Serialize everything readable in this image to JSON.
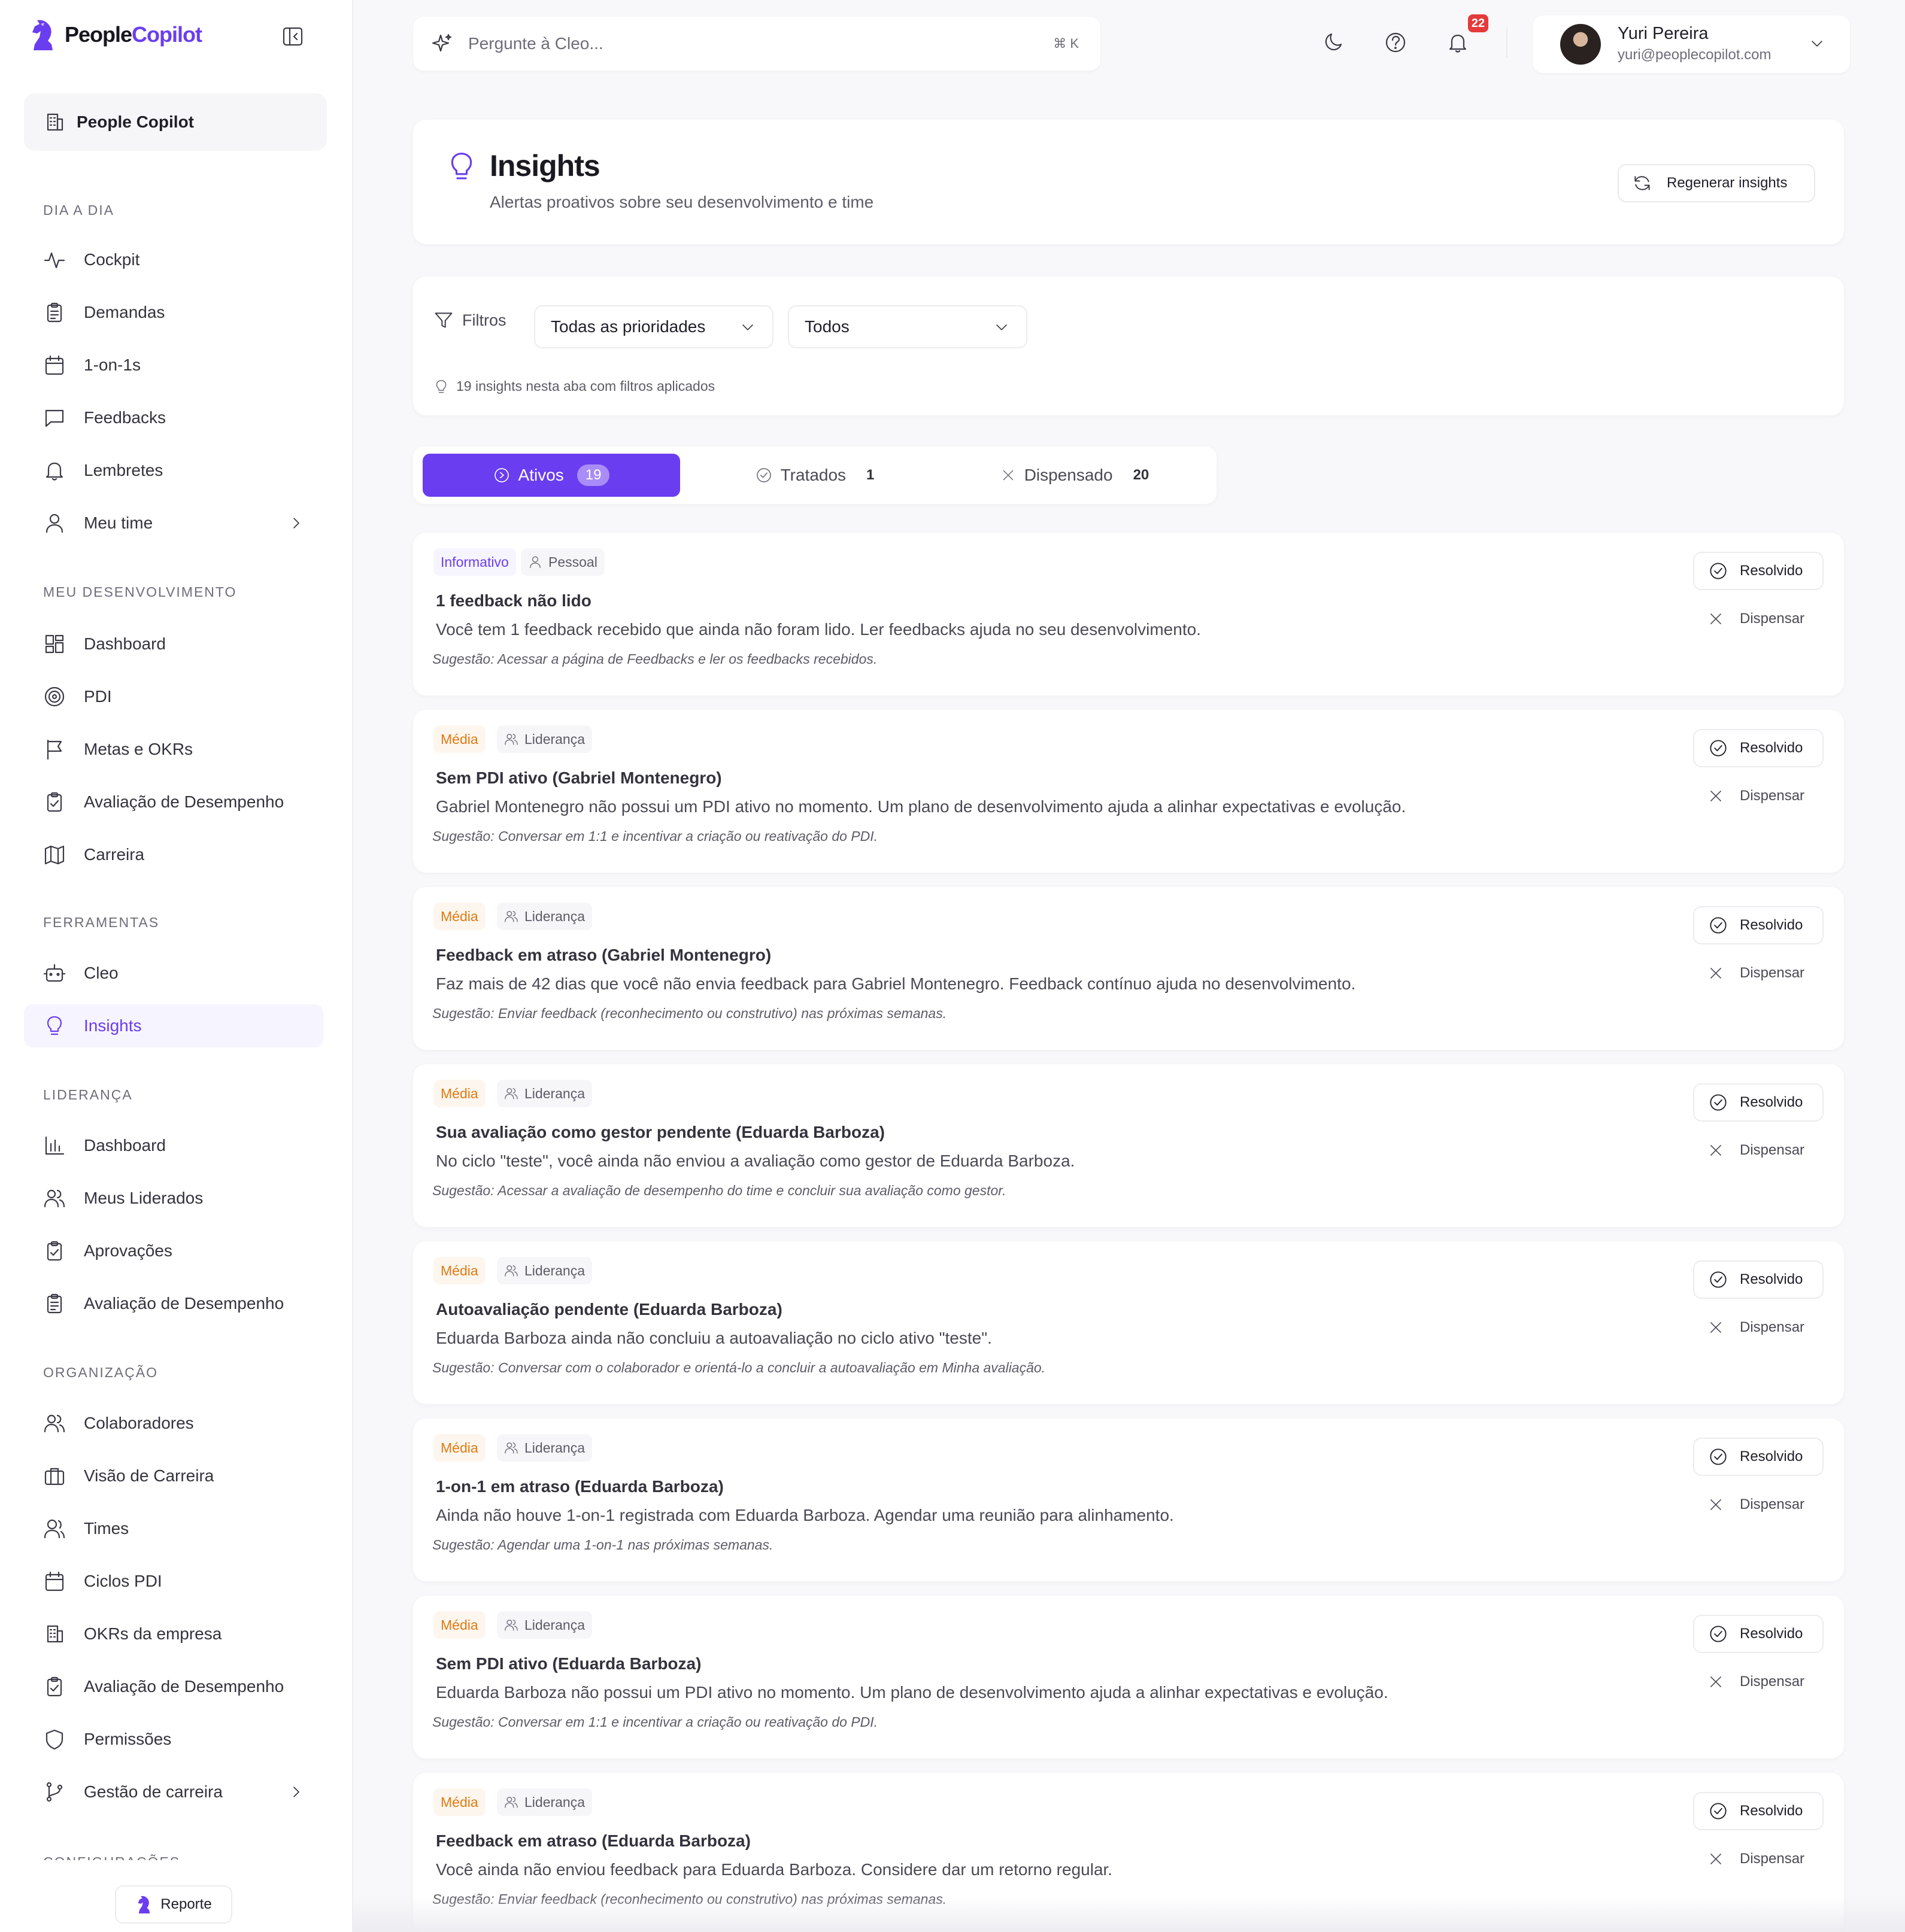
{
  "brand": {
    "name_part1": "People",
    "name_part2": "Copilot"
  },
  "org": {
    "name": "People Copilot"
  },
  "sidebar": {
    "sections": [
      {
        "label": "DIA A DIA"
      },
      {
        "label": "MEU DESENVOLVIMENTO"
      },
      {
        "label": "FERRAMENTAS"
      },
      {
        "label": "LIDERANÇA"
      },
      {
        "label": "ORGANIZAÇÃO"
      },
      {
        "label": "CONFIGURAÇÕES"
      }
    ],
    "items": {
      "cockpit": "Cockpit",
      "demandas": "Demandas",
      "oneonones": "1-on-1s",
      "feedbacks": "Feedbacks",
      "lembretes": "Lembretes",
      "meu_time": "Meu time",
      "dashboard": "Dashboard",
      "pdi": "PDI",
      "metas": "Metas e OKRs",
      "avaliacao": "Avaliação de Desempenho",
      "carreira": "Carreira",
      "cleo": "Cleo",
      "insights": "Insights",
      "lid_dashboard": "Dashboard",
      "meus_liderados": "Meus Liderados",
      "aprovacoes": "Aprovações",
      "lid_avaliacao": "Avaliação de Desempenho",
      "colaboradores": "Colaboradores",
      "visao_carreira": "Visão de Carreira",
      "times": "Times",
      "ciclos_pdi": "Ciclos PDI",
      "okrs_empresa": "OKRs da empresa",
      "org_avaliacao": "Avaliação de Desempenho",
      "permissoes": "Permissões",
      "gestao_carreira": "Gestão de carreira"
    },
    "reporte": "Reporte"
  },
  "search": {
    "placeholder": "Pergunte à Cleo...",
    "shortcut": "⌘ K"
  },
  "notifications": {
    "count": "22"
  },
  "user": {
    "name": "Yuri Pereira",
    "email": "yuri@peoplecopilot.com"
  },
  "header": {
    "title": "Insights",
    "subtitle": "Alertas proativos sobre seu desenvolvimento e time",
    "regen_label": "Regenerar insights"
  },
  "filters": {
    "label": "Filtros",
    "priority": "Todas as prioridades",
    "scope": "Todos",
    "note": "19 insights nesta aba com filtros aplicados"
  },
  "tabs": [
    {
      "label": "Ativos",
      "count": "19"
    },
    {
      "label": "Tratados",
      "count": "1"
    },
    {
      "label": "Dispensado",
      "count": "20"
    }
  ],
  "actions": {
    "resolve": "Resolvido",
    "dismiss": "Dispensar"
  },
  "insights": [
    {
      "priority": "Informativo",
      "category": "Pessoal",
      "title": "1 feedback não lido",
      "description": "Você tem 1 feedback recebido que ainda não foram lido. Ler feedbacks ajuda no seu desenvolvimento.",
      "suggestion": "Sugestão: Acessar a página de Feedbacks e ler os feedbacks recebidos."
    },
    {
      "priority": "Média",
      "category": "Liderança",
      "title": "Sem PDI ativo (Gabriel Montenegro)",
      "description": "Gabriel Montenegro não possui um PDI ativo no momento. Um plano de desenvolvimento ajuda a alinhar expectativas e evolução.",
      "suggestion": "Sugestão: Conversar em 1:1 e incentivar a criação ou reativação do PDI."
    },
    {
      "priority": "Média",
      "category": "Liderança",
      "title": "Feedback em atraso (Gabriel Montenegro)",
      "description": "Faz mais de 42 dias que você não envia feedback para Gabriel Montenegro. Feedback contínuo ajuda no desenvolvimento.",
      "suggestion": "Sugestão: Enviar feedback (reconhecimento ou construtivo) nas próximas semanas."
    },
    {
      "priority": "Média",
      "category": "Liderança",
      "title": "Sua avaliação como gestor pendente (Eduarda Barboza)",
      "description": "No ciclo \"teste\", você ainda não enviou a avaliação como gestor de Eduarda Barboza.",
      "suggestion": "Sugestão: Acessar a avaliação de desempenho do time e concluir sua avaliação como gestor."
    },
    {
      "priority": "Média",
      "category": "Liderança",
      "title": "Autoavaliação pendente (Eduarda Barboza)",
      "description": "Eduarda Barboza ainda não concluiu a autoavaliação no ciclo ativo \"teste\".",
      "suggestion": "Sugestão: Conversar com o colaborador e orientá-lo a concluir a autoavaliação em Minha avaliação."
    },
    {
      "priority": "Média",
      "category": "Liderança",
      "title": "1-on-1 em atraso (Eduarda Barboza)",
      "description": "Ainda não houve 1-on-1 registrada com Eduarda Barboza. Agendar uma reunião para alinhamento.",
      "suggestion": "Sugestão: Agendar uma 1-on-1 nas próximas semanas."
    },
    {
      "priority": "Média",
      "category": "Liderança",
      "title": "Sem PDI ativo (Eduarda Barboza)",
      "description": "Eduarda Barboza não possui um PDI ativo no momento. Um plano de desenvolvimento ajuda a alinhar expectativas e evolução.",
      "suggestion": "Sugestão: Conversar em 1:1 e incentivar a criação ou reativação do PDI."
    },
    {
      "priority": "Média",
      "category": "Liderança",
      "title": "Feedback em atraso (Eduarda Barboza)",
      "description": "Você ainda não enviou feedback para Eduarda Barboza. Considere dar um retorno regular.",
      "suggestion": "Sugestão: Enviar feedback (reconhecimento ou construtivo) nas próximas semanas."
    }
  ],
  "colors": {
    "accent": "#6a3df0",
    "medium": "#e07a12",
    "badge": "#e5393a"
  }
}
